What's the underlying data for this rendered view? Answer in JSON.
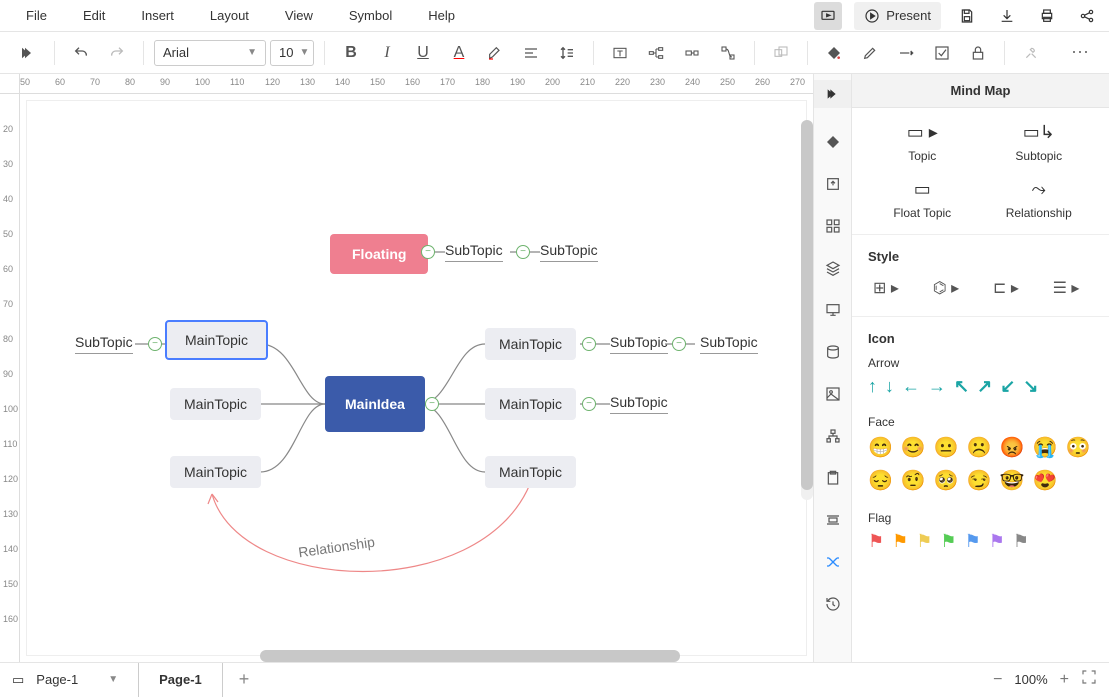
{
  "menu": {
    "file": "File",
    "edit": "Edit",
    "insert": "Insert",
    "layout": "Layout",
    "view": "View",
    "symbol": "Symbol",
    "help": "Help",
    "present": "Present"
  },
  "toolbar": {
    "font": "Arial",
    "size": "10"
  },
  "ruler_h": [
    "50",
    "60",
    "70",
    "80",
    "90",
    "100",
    "110",
    "120",
    "130",
    "140",
    "150",
    "160",
    "170",
    "180",
    "190",
    "200",
    "210",
    "220",
    "230",
    "240",
    "250",
    "260",
    "270"
  ],
  "ruler_v": [
    "20",
    "30",
    "40",
    "50",
    "60",
    "70",
    "80",
    "90",
    "100",
    "110",
    "120",
    "130",
    "140",
    "150",
    "160"
  ],
  "mindmap": {
    "center": "MainIdea",
    "floating": "Floating",
    "float_sub1": "SubTopic",
    "float_sub2": "SubTopic",
    "left1": "MainTopic",
    "left1_sub": "SubTopic",
    "left2": "MainTopic",
    "left3": "MainTopic",
    "right1": "MainTopic",
    "right1_sub1": "SubTopic",
    "right1_sub2": "SubTopic",
    "right2": "MainTopic",
    "right2_sub": "SubTopic",
    "right3": "MainTopic",
    "relationship": "Relationship"
  },
  "rightpanel": {
    "title": "Mind Map",
    "topic": "Topic",
    "subtopic": "Subtopic",
    "floattopic": "Float Topic",
    "relationship": "Relationship",
    "style": "Style",
    "icon": "Icon",
    "arrow": "Arrow",
    "face": "Face",
    "flag": "Flag"
  },
  "status": {
    "pagelist": "Page-1",
    "pagetab": "Page-1",
    "zoom": "100%"
  }
}
